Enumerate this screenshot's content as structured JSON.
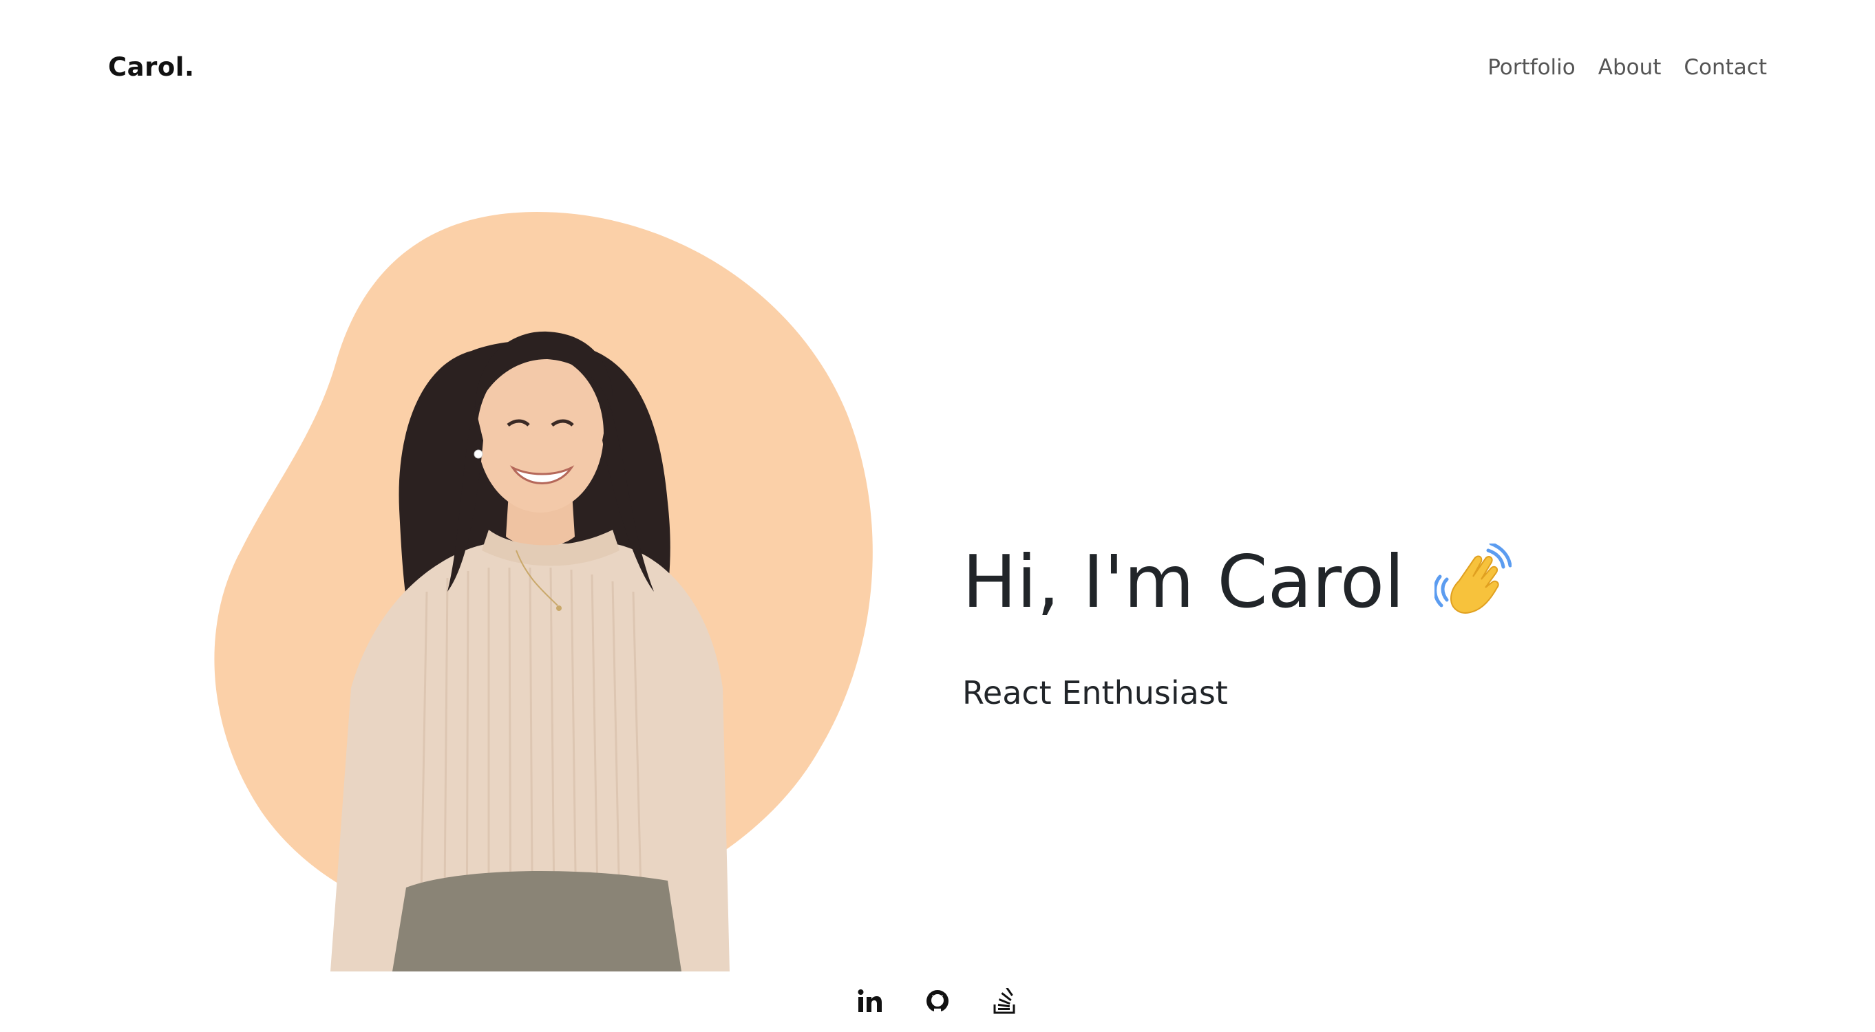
{
  "header": {
    "brand": "Carol.",
    "nav": [
      {
        "label": "Portfolio"
      },
      {
        "label": "About"
      },
      {
        "label": "Contact"
      }
    ]
  },
  "hero": {
    "greeting": "Hi, I'm Carol",
    "greeting_emoji": "waving-hand-icon",
    "subtitle": "React Enthusiast",
    "blob_color": "#fbd0a8",
    "photo_subject": "profile-photo"
  },
  "social": [
    {
      "icon": "linkedin-icon"
    },
    {
      "icon": "github-icon"
    },
    {
      "icon": "stackoverflow-icon"
    }
  ],
  "colors": {
    "text": "#212529",
    "nav_text": "#555555",
    "blob": "#fbd0a8",
    "sweater": "#e9d5c3",
    "skirt": "#8a8476",
    "hair": "#2b2120",
    "skin": "#f3c9a9"
  }
}
